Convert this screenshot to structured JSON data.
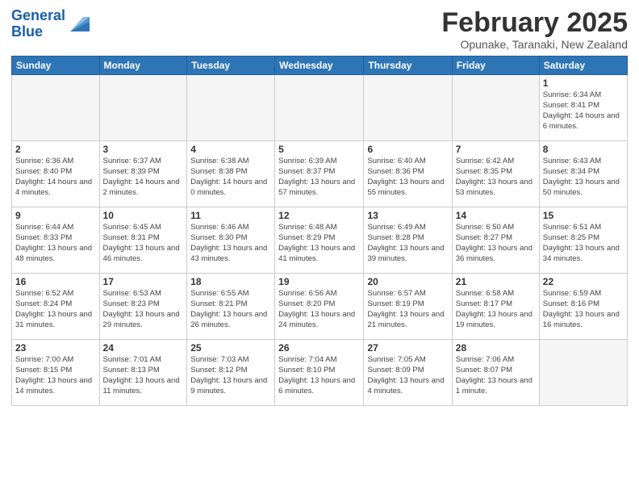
{
  "header": {
    "logo_line1": "General",
    "logo_line2": "Blue",
    "month_title": "February 2025",
    "location": "Opunake, Taranaki, New Zealand"
  },
  "weekdays": [
    "Sunday",
    "Monday",
    "Tuesday",
    "Wednesday",
    "Thursday",
    "Friday",
    "Saturday"
  ],
  "weeks": [
    [
      {
        "day": "",
        "info": ""
      },
      {
        "day": "",
        "info": ""
      },
      {
        "day": "",
        "info": ""
      },
      {
        "day": "",
        "info": ""
      },
      {
        "day": "",
        "info": ""
      },
      {
        "day": "",
        "info": ""
      },
      {
        "day": "1",
        "info": "Sunrise: 6:34 AM\nSunset: 8:41 PM\nDaylight: 14 hours\nand 6 minutes."
      }
    ],
    [
      {
        "day": "2",
        "info": "Sunrise: 6:36 AM\nSunset: 8:40 PM\nDaylight: 14 hours\nand 4 minutes."
      },
      {
        "day": "3",
        "info": "Sunrise: 6:37 AM\nSunset: 8:39 PM\nDaylight: 14 hours\nand 2 minutes."
      },
      {
        "day": "4",
        "info": "Sunrise: 6:38 AM\nSunset: 8:38 PM\nDaylight: 14 hours\nand 0 minutes."
      },
      {
        "day": "5",
        "info": "Sunrise: 6:39 AM\nSunset: 8:37 PM\nDaylight: 13 hours\nand 57 minutes."
      },
      {
        "day": "6",
        "info": "Sunrise: 6:40 AM\nSunset: 8:36 PM\nDaylight: 13 hours\nand 55 minutes."
      },
      {
        "day": "7",
        "info": "Sunrise: 6:42 AM\nSunset: 8:35 PM\nDaylight: 13 hours\nand 53 minutes."
      },
      {
        "day": "8",
        "info": "Sunrise: 6:43 AM\nSunset: 8:34 PM\nDaylight: 13 hours\nand 50 minutes."
      }
    ],
    [
      {
        "day": "9",
        "info": "Sunrise: 6:44 AM\nSunset: 8:33 PM\nDaylight: 13 hours\nand 48 minutes."
      },
      {
        "day": "10",
        "info": "Sunrise: 6:45 AM\nSunset: 8:31 PM\nDaylight: 13 hours\nand 46 minutes."
      },
      {
        "day": "11",
        "info": "Sunrise: 6:46 AM\nSunset: 8:30 PM\nDaylight: 13 hours\nand 43 minutes."
      },
      {
        "day": "12",
        "info": "Sunrise: 6:48 AM\nSunset: 8:29 PM\nDaylight: 13 hours\nand 41 minutes."
      },
      {
        "day": "13",
        "info": "Sunrise: 6:49 AM\nSunset: 8:28 PM\nDaylight: 13 hours\nand 39 minutes."
      },
      {
        "day": "14",
        "info": "Sunrise: 6:50 AM\nSunset: 8:27 PM\nDaylight: 13 hours\nand 36 minutes."
      },
      {
        "day": "15",
        "info": "Sunrise: 6:51 AM\nSunset: 8:25 PM\nDaylight: 13 hours\nand 34 minutes."
      }
    ],
    [
      {
        "day": "16",
        "info": "Sunrise: 6:52 AM\nSunset: 8:24 PM\nDaylight: 13 hours\nand 31 minutes."
      },
      {
        "day": "17",
        "info": "Sunrise: 6:53 AM\nSunset: 8:23 PM\nDaylight: 13 hours\nand 29 minutes."
      },
      {
        "day": "18",
        "info": "Sunrise: 6:55 AM\nSunset: 8:21 PM\nDaylight: 13 hours\nand 26 minutes."
      },
      {
        "day": "19",
        "info": "Sunrise: 6:56 AM\nSunset: 8:20 PM\nDaylight: 13 hours\nand 24 minutes."
      },
      {
        "day": "20",
        "info": "Sunrise: 6:57 AM\nSunset: 8:19 PM\nDaylight: 13 hours\nand 21 minutes."
      },
      {
        "day": "21",
        "info": "Sunrise: 6:58 AM\nSunset: 8:17 PM\nDaylight: 13 hours\nand 19 minutes."
      },
      {
        "day": "22",
        "info": "Sunrise: 6:59 AM\nSunset: 8:16 PM\nDaylight: 13 hours\nand 16 minutes."
      }
    ],
    [
      {
        "day": "23",
        "info": "Sunrise: 7:00 AM\nSunset: 8:15 PM\nDaylight: 13 hours\nand 14 minutes."
      },
      {
        "day": "24",
        "info": "Sunrise: 7:01 AM\nSunset: 8:13 PM\nDaylight: 13 hours\nand 11 minutes."
      },
      {
        "day": "25",
        "info": "Sunrise: 7:03 AM\nSunset: 8:12 PM\nDaylight: 13 hours\nand 9 minutes."
      },
      {
        "day": "26",
        "info": "Sunrise: 7:04 AM\nSunset: 8:10 PM\nDaylight: 13 hours\nand 6 minutes."
      },
      {
        "day": "27",
        "info": "Sunrise: 7:05 AM\nSunset: 8:09 PM\nDaylight: 13 hours\nand 4 minutes."
      },
      {
        "day": "28",
        "info": "Sunrise: 7:06 AM\nSunset: 8:07 PM\nDaylight: 13 hours\nand 1 minute."
      },
      {
        "day": "",
        "info": ""
      }
    ]
  ]
}
